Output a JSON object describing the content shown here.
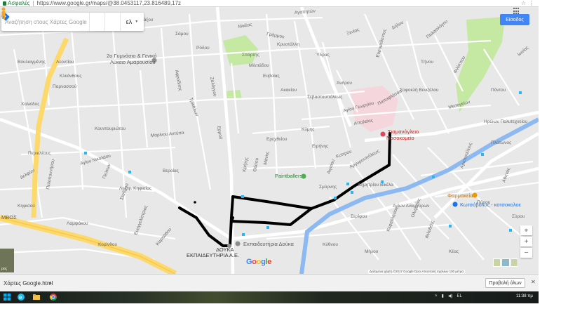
{
  "browser": {
    "secure_label": "Ασφαλές",
    "separator": "|",
    "url": "https://www.google.gr/maps/@38.0453117,23.816489,17z"
  },
  "search": {
    "placeholder": "Αναζήτηση στους Χάρτες Google",
    "language": "ελ"
  },
  "signin_label": "Είσοδος",
  "streets": [
    "Αγαπητών",
    "Ξενίας",
    "Δήλου",
    "Παλαιολόγου",
    "Μαρίνου Αντύπα",
    "Ευρυμέδοντος",
    "Λεοντίου",
    "Κλεάνθους",
    "Παρνασσού",
    "Μικέας",
    "Γράμμου",
    "Κρυστάλλη",
    "Σπάρτης",
    "Μιλτιάδου",
    "Ευβοίας",
    "Ακακίου",
    "Σεβαστουπόλεως",
    "Ατταλείας",
    "Παπαφλέσσα",
    "Σοφοκλή Βενιζέλου",
    "Μεσογείων",
    "Ηρώων Πολυτεχνείου",
    "Αγίου Γεωργίου",
    "Αργυρουπόλεως",
    "Δημητρίου Βικέλα",
    "Κυπρου",
    "Ζαλόγγου",
    "Αφροδίτης",
    "Τρικάλων",
    "Ερμού",
    "Κρήτης",
    "Θάσου",
    "Μάνης",
    "Βεροίας",
    "Κουντουριώτου",
    "Αγίου Νικολάου",
    "Πεύκων",
    "Λεωφ. Κηφισίας",
    "Σταθμού",
    "Δελφών",
    "Περικλέους",
    "Λαμψάκου",
    "Κορίνθου",
    "Ευαγγελίστριας",
    "Καρπάθου",
    "Ειρήνης",
    "Σμύρνης",
    "Αιγαίου",
    "Κύμης",
    "Ερεχθείου",
    "Αγίων Αναργύρων",
    "Ολυμπίας",
    "Φιλοθέης",
    "Κεφαλληνίας",
    "Αριστοτέλους",
    "Πλάτωνος",
    "Αθηνάς",
    "Ιωνίας",
    "Πόντου",
    "Φιλίππου",
    "Βουλιαγμένης",
    "Χαλκίδος",
    "Πελοποννήσου",
    "Κηφισού",
    "Νάξου",
    "Σάμου",
    "Ρόδου",
    "Ύδρας",
    "Άνδρου",
    "Τήνου",
    "Πάρου",
    "Σύρου",
    "Κέας",
    "Μήλου",
    "Κύθνου",
    "Σερίφου"
  ],
  "pois": {
    "school": [
      "2ο Γυμνάσιο & Γενικό",
      "Λύκειο Αμαρουσίου"
    ],
    "hospital": [
      "Σισμανόγλειο",
      "Νοσοκομείο"
    ],
    "paintball": "Paintballers",
    "ekpaideftiria": "Εκπαιδευτήρια Δούκα",
    "douka_co": [
      "ΔΟΥΚΑ",
      "ΕΚΠΑΙΔΕΥΤΗΡΙΑ Α.Ε."
    ],
    "pharmacy": "Φαρμακεία",
    "kotopoula": "Κωτσόβολος - κοτσοκολοε",
    "motorway_left": "ΜΒΟΣ"
  },
  "route_color": "#000000",
  "google_logo": "Google",
  "attribution": "Δεδομένα χάρτη ©2017 Google   Όροι   Αποστολή σχολίων   100 μέτρα",
  "controls": {
    "zoom_in": "+",
    "zoom_out": "−",
    "locate": "⌖"
  },
  "downloads": {
    "file_name": "Χάρτες Google.html",
    "show_all": "Προβολή όλων",
    "close": "✕"
  },
  "taskbar": {
    "lang": "EL",
    "time": "11:38 πμ"
  },
  "colors": {
    "map_bg": "#e8e8e8",
    "road": "#ffffff",
    "highway": "#fdd86a",
    "river": "#8cb9f2",
    "park": "#c5e8a3",
    "hospital_area": "#f4d6dc",
    "signin_bg": "#4285f4"
  },
  "satellite_label": "ρος"
}
